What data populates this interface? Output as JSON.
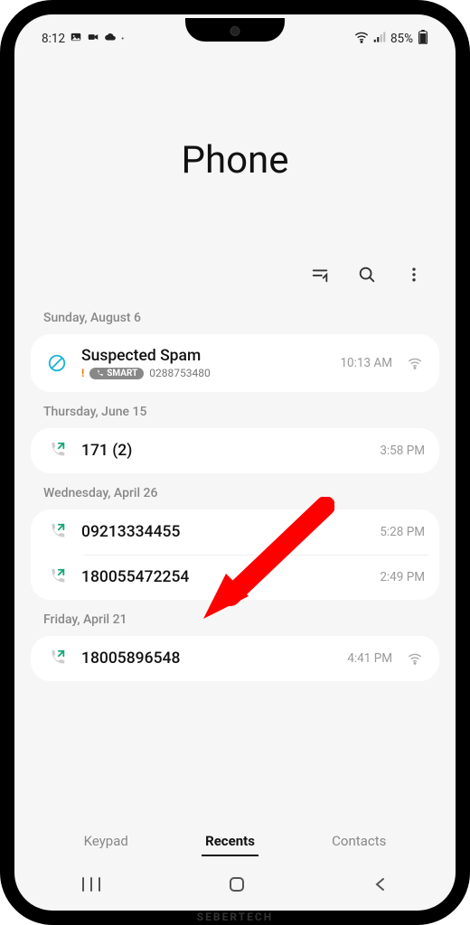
{
  "status": {
    "time": "8:12",
    "battery": "85%"
  },
  "title": "Phone",
  "toolbar": {
    "filter": "filter",
    "search": "search",
    "more": "more"
  },
  "groups": [
    {
      "date": "Sunday, August 6",
      "entries": [
        {
          "icon": "spam",
          "name": "Suspected Spam",
          "carrier": "SMART",
          "number": "0288753480",
          "time": "10:13 AM",
          "right": "wifi",
          "alert": true
        }
      ]
    },
    {
      "date": "Thursday, June 15",
      "entries": [
        {
          "icon": "outgoing",
          "name": "171 (2)",
          "time": "3:58 PM"
        }
      ]
    },
    {
      "date": "Wednesday, April 26",
      "entries": [
        {
          "icon": "outgoing",
          "name": "09213334455",
          "time": "5:28 PM"
        },
        {
          "icon": "outgoing",
          "name": "180055472254",
          "time": "2:49 PM"
        }
      ]
    },
    {
      "date": "Friday, April 21",
      "entries": [
        {
          "icon": "outgoing",
          "name": "18005896548",
          "time": "4:41 PM",
          "right": "wifi"
        }
      ]
    }
  ],
  "tabs": {
    "keypad": "Keypad",
    "recents": "Recents",
    "contacts": "Contacts",
    "active": "recents"
  },
  "watermark": "SEBERTECH"
}
